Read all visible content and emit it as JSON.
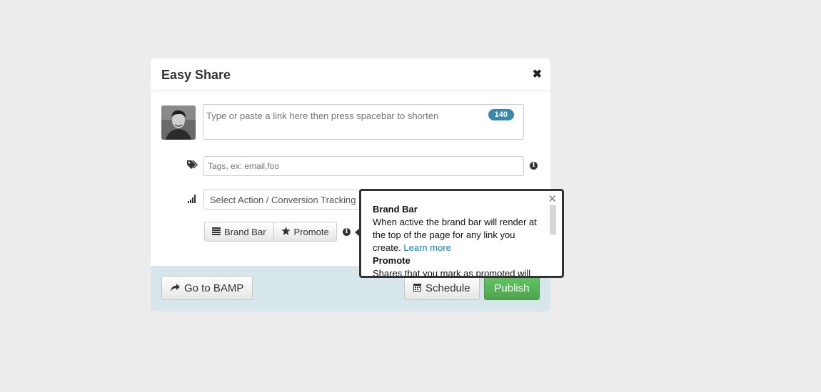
{
  "modal": {
    "title": "Easy Share",
    "close_glyph": "✖"
  },
  "compose": {
    "placeholder": "Type or paste a link here then press spacebar to shorten",
    "char_count": "140"
  },
  "tags": {
    "placeholder": "Tags, ex: email,foo"
  },
  "action_select": {
    "value": "Select Action / Conversion Tracking"
  },
  "toggles": {
    "brand_bar_label": "Brand Bar",
    "promote_label": "Promote"
  },
  "footer": {
    "go_label": "Go to BAMP",
    "schedule_label": "Schedule",
    "publish_label": "Publish"
  },
  "popover": {
    "close_glyph": "✕",
    "brand_title": "Brand Bar",
    "brand_text": "When active the brand bar will render at the top of the page for any link you create.",
    "learn_more": "Learn more",
    "promote_title": "Promote",
    "promote_text": "Shares that you mark as promoted will"
  },
  "icons": {
    "info": "i",
    "tags": "tags-icon",
    "signal": "signal-icon",
    "list": "list-icon",
    "star": "star-icon",
    "share": "share-icon",
    "calendar": "calendar-icon"
  },
  "colors": {
    "counter": "#3a87ad",
    "publish": "#5bb75b",
    "footer": "#d6e6ea",
    "link": "#0088cc"
  }
}
